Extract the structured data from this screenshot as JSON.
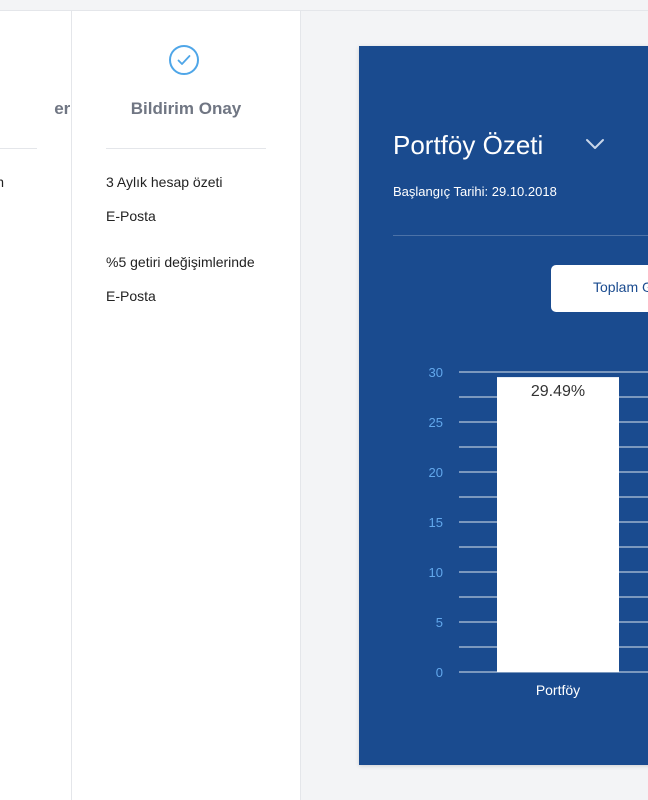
{
  "steps": [
    {
      "title_fragment": "eri",
      "content_fragment": "n"
    },
    {
      "title": "Bildirim Onay",
      "notifications": [
        {
          "label": "3 Aylık hesap özeti",
          "channel": "E-Posta"
        },
        {
          "label": "%5 getiri değişimlerinde",
          "channel": "E-Posta"
        }
      ]
    }
  ],
  "portfolio": {
    "title": "Portföy Özeti",
    "start_date": "Başlangıç Tarihi: 29.10.2018",
    "total_button_label": "Toplam G"
  },
  "colors": {
    "card_bg": "#1a4b8f",
    "accent": "#4fa6e8",
    "tick_label": "#62a8ec"
  },
  "chart_data": {
    "type": "bar",
    "categories": [
      "Portföy"
    ],
    "values": [
      29.49
    ],
    "data_labels": [
      "29.49%"
    ],
    "yticks": [
      0,
      5,
      10,
      15,
      20,
      25,
      30
    ],
    "ylim": [
      0,
      30
    ],
    "grid": true,
    "title": "",
    "xlabel": "",
    "ylabel": ""
  }
}
